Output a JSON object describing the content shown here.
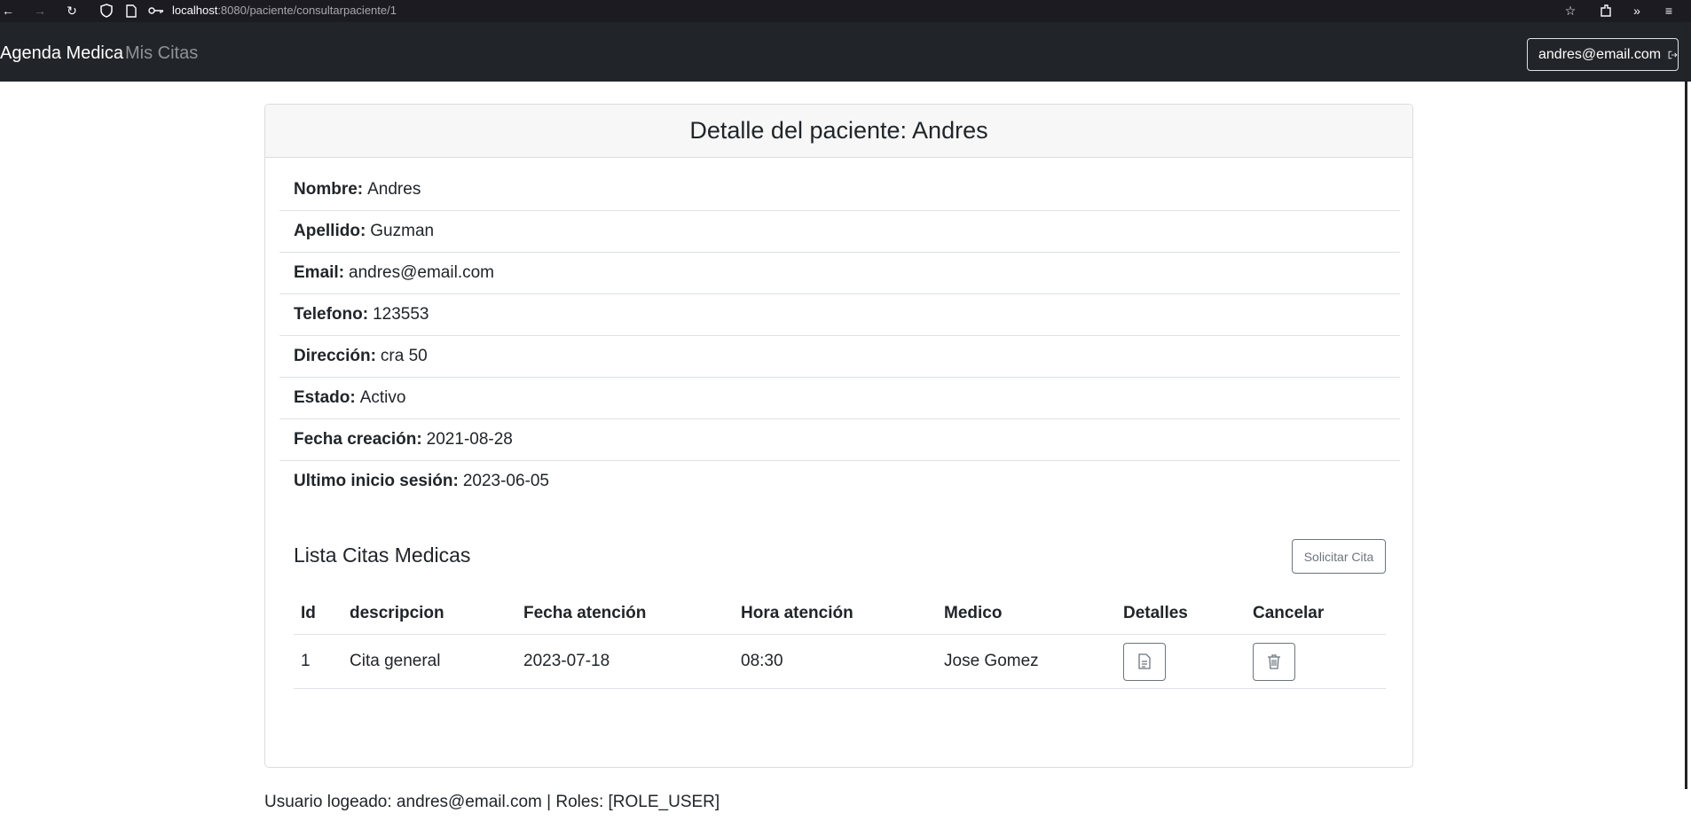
{
  "browser": {
    "url_host": "localhost",
    "url_path": ":8080/paciente/consultarpaciente/1"
  },
  "navbar": {
    "brand": "Agenda Medica",
    "link_citas": "Mis Citas",
    "user_email": "andres@email.com"
  },
  "card": {
    "title": "Detalle del paciente: Andres",
    "details": [
      {
        "label": "Nombre:",
        "value": "Andres"
      },
      {
        "label": "Apellido:",
        "value": "Guzman"
      },
      {
        "label": "Email:",
        "value": "andres@email.com"
      },
      {
        "label": "Telefono:",
        "value": "123553"
      },
      {
        "label": "Dirección:",
        "value": "cra 50"
      },
      {
        "label": "Estado:",
        "value": "Activo"
      },
      {
        "label": "Fecha creación:",
        "value": "2021-08-28"
      },
      {
        "label": "Ultimo inicio sesión:",
        "value": "2023-06-05"
      }
    ],
    "list_title": "Lista Citas Medicas",
    "solicitar_label": "Solicitar Cita",
    "table": {
      "headers": [
        "Id",
        "descripcion",
        "Fecha atención",
        "Hora atención",
        "Medico",
        "Detalles",
        "Cancelar"
      ],
      "rows": [
        {
          "id": "1",
          "descripcion": "Cita general",
          "fecha": "2023-07-18",
          "hora": "08:30",
          "medico": "Jose Gomez"
        }
      ]
    }
  },
  "footer": {
    "text": "Usuario logeado: andres@email.com | Roles: [ROLE_USER]"
  }
}
